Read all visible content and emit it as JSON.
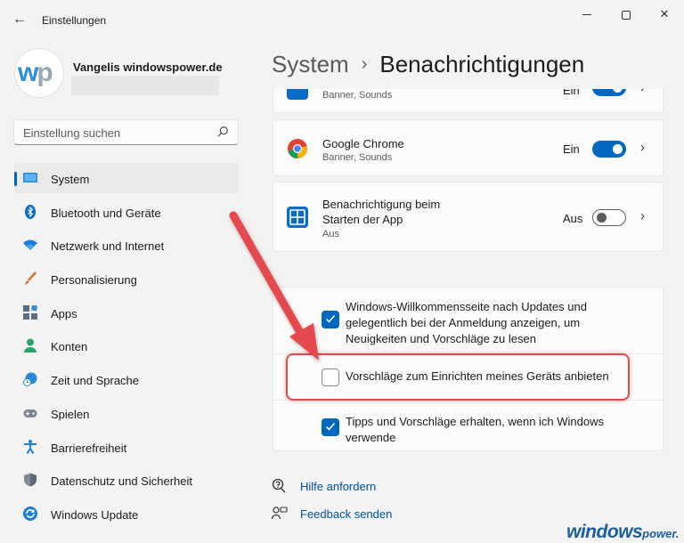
{
  "window": {
    "app_title": "Einstellungen",
    "back_icon": "back-arrow-icon",
    "controls": [
      "minimize-icon",
      "maximize-icon",
      "close-icon"
    ]
  },
  "profile": {
    "avatar_text_w": "w",
    "avatar_text_p": "p",
    "name": "Vangelis windowspower.de"
  },
  "search": {
    "placeholder": "Einstellung suchen",
    "icon": "search-icon"
  },
  "sidebar": {
    "items": [
      {
        "label": "System",
        "icon": "system-display-icon",
        "active": true
      },
      {
        "label": "Bluetooth und Geräte",
        "icon": "bluetooth-icon",
        "active": false
      },
      {
        "label": "Netzwerk und Internet",
        "icon": "wifi-icon",
        "active": false
      },
      {
        "label": "Personalisierung",
        "icon": "brush-icon",
        "active": false
      },
      {
        "label": "Apps",
        "icon": "apps-icon",
        "active": false
      },
      {
        "label": "Konten",
        "icon": "account-icon",
        "active": false
      },
      {
        "label": "Zeit und Sprache",
        "icon": "clock-globe-icon",
        "active": false
      },
      {
        "label": "Spielen",
        "icon": "gamepad-icon",
        "active": false
      },
      {
        "label": "Barrierefreiheit",
        "icon": "accessibility-icon",
        "active": false
      },
      {
        "label": "Datenschutz und Sicherheit",
        "icon": "shield-icon",
        "active": false
      },
      {
        "label": "Windows Update",
        "icon": "update-icon",
        "active": false
      }
    ]
  },
  "header": {
    "parent": "System",
    "separator": "›",
    "current": "Benachrichtigungen"
  },
  "apps": [
    {
      "title": "",
      "subtitle": "Banner, Sounds",
      "toggle_label": "Ein",
      "on": true
    },
    {
      "title": "Google Chrome",
      "subtitle": "Banner, Sounds",
      "toggle_label": "Ein",
      "on": true
    },
    {
      "title_line1": "Benachrichtigung beim",
      "title_line2": "Starten der App",
      "subtitle": "Aus",
      "toggle_label": "Aus",
      "on": false
    }
  ],
  "options": [
    {
      "line1": "Windows-Willkommensseite nach Updates und",
      "line2": "gelegentlich bei der Anmeldung anzeigen, um",
      "line3": "Neuigkeiten und Vorschläge zu lesen",
      "checked": true
    },
    {
      "line1": "Vorschläge zum Einrichten meines Geräts anbieten",
      "checked": false
    },
    {
      "line1": "Tipps und Vorschläge erhalten, wenn ich Windows",
      "line2": "verwende",
      "checked": true
    }
  ],
  "links": [
    {
      "label": "Hilfe anfordern",
      "icon": "help-icon"
    },
    {
      "label": "Feedback senden",
      "icon": "feedback-icon"
    }
  ],
  "watermark": {
    "main": "windows",
    "sub": "power."
  },
  "colors": {
    "accent": "#0067c0",
    "highlight": "#e04b4b"
  }
}
